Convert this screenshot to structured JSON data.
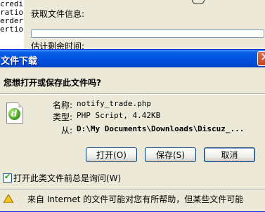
{
  "background": {
    "code_lines": [
      "credi",
      "",
      "ratio",
      "erderi",
      "ertion"
    ],
    "progress_window": {
      "info_label": "获取文件信息:",
      "remaining_label": "估计剩余时间:"
    }
  },
  "dialog": {
    "title": "文件下载",
    "close_glyph": "✕",
    "question": "您想打开或保存此文件吗?",
    "file_icon": "dreamweaver-php-file-icon",
    "fields": {
      "name_label": "名称:",
      "name_value": "notify_trade.php",
      "type_label": "类型:",
      "type_value": "PHP Script, 4.42KB",
      "from_label": "从:",
      "from_value": "D:\\My Documents\\Downloads\\Discuz_..."
    },
    "buttons": {
      "open": "打开(O)",
      "save": "保存(S)",
      "cancel": "取消"
    },
    "checkbox": {
      "checked": true,
      "label": "打开此类文件前总是询问(W)"
    },
    "footer_cutoff_text": "来自 Internet 的文件可能对您有所帮助，但某些文件可能"
  }
}
